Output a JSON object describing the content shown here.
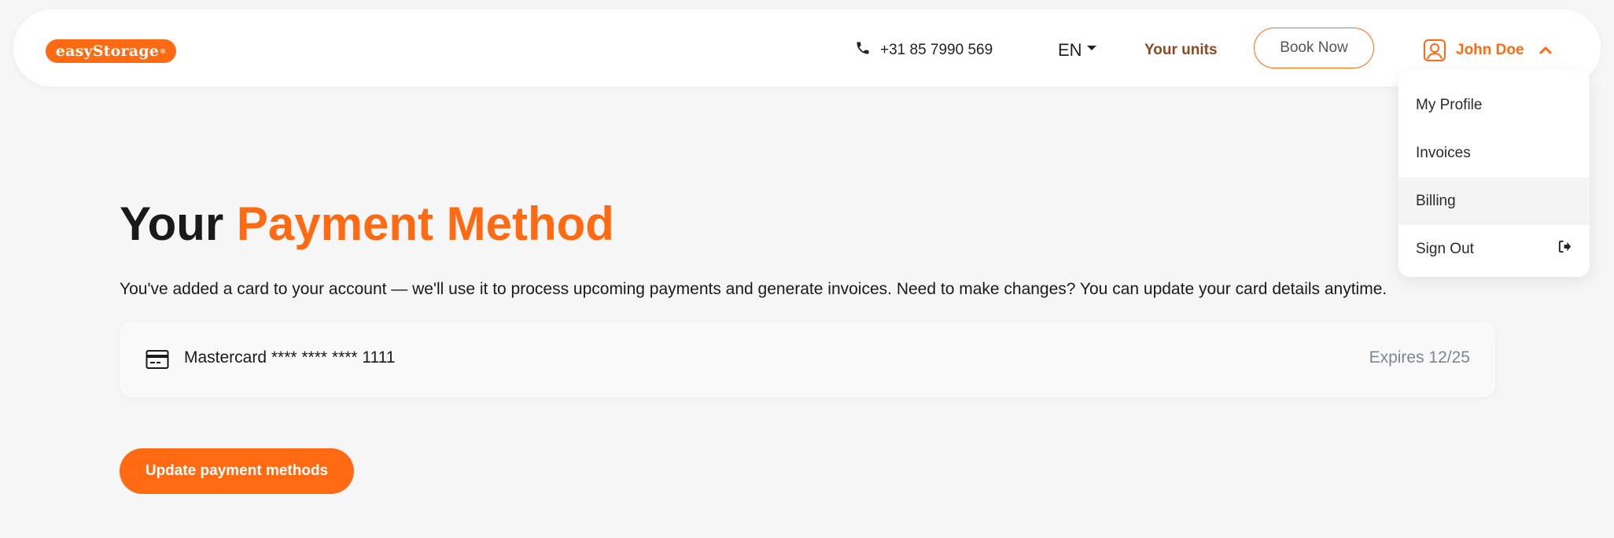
{
  "header": {
    "logo_text": "easyStorage",
    "logo_mark": "®",
    "phone": "+31 85 7990 569",
    "language": "EN",
    "your_units": "Your units",
    "book_now": "Book Now",
    "user_name": "John Doe"
  },
  "user_menu": {
    "items": [
      {
        "label": "My Profile"
      },
      {
        "label": "Invoices"
      },
      {
        "label": "Billing"
      },
      {
        "label": "Sign Out",
        "icon": "sign-out-icon"
      }
    ]
  },
  "main": {
    "title_prefix": "Your",
    "title_accent": "Payment Method",
    "description": "You've added a card to your account — we'll use it to process upcoming payments and generate invoices. Need to make changes? You can update your card details anytime.",
    "card": {
      "label": "Mastercard **** **** **** 1111",
      "expires": "Expires 12/25",
      "icon": "credit-card-icon"
    },
    "update_button": "Update payment methods"
  },
  "colors": {
    "accent": "#ff6a13",
    "background": "#f6f6f6",
    "your_units": "#8a4a22",
    "muted_text": "#7d8590"
  }
}
